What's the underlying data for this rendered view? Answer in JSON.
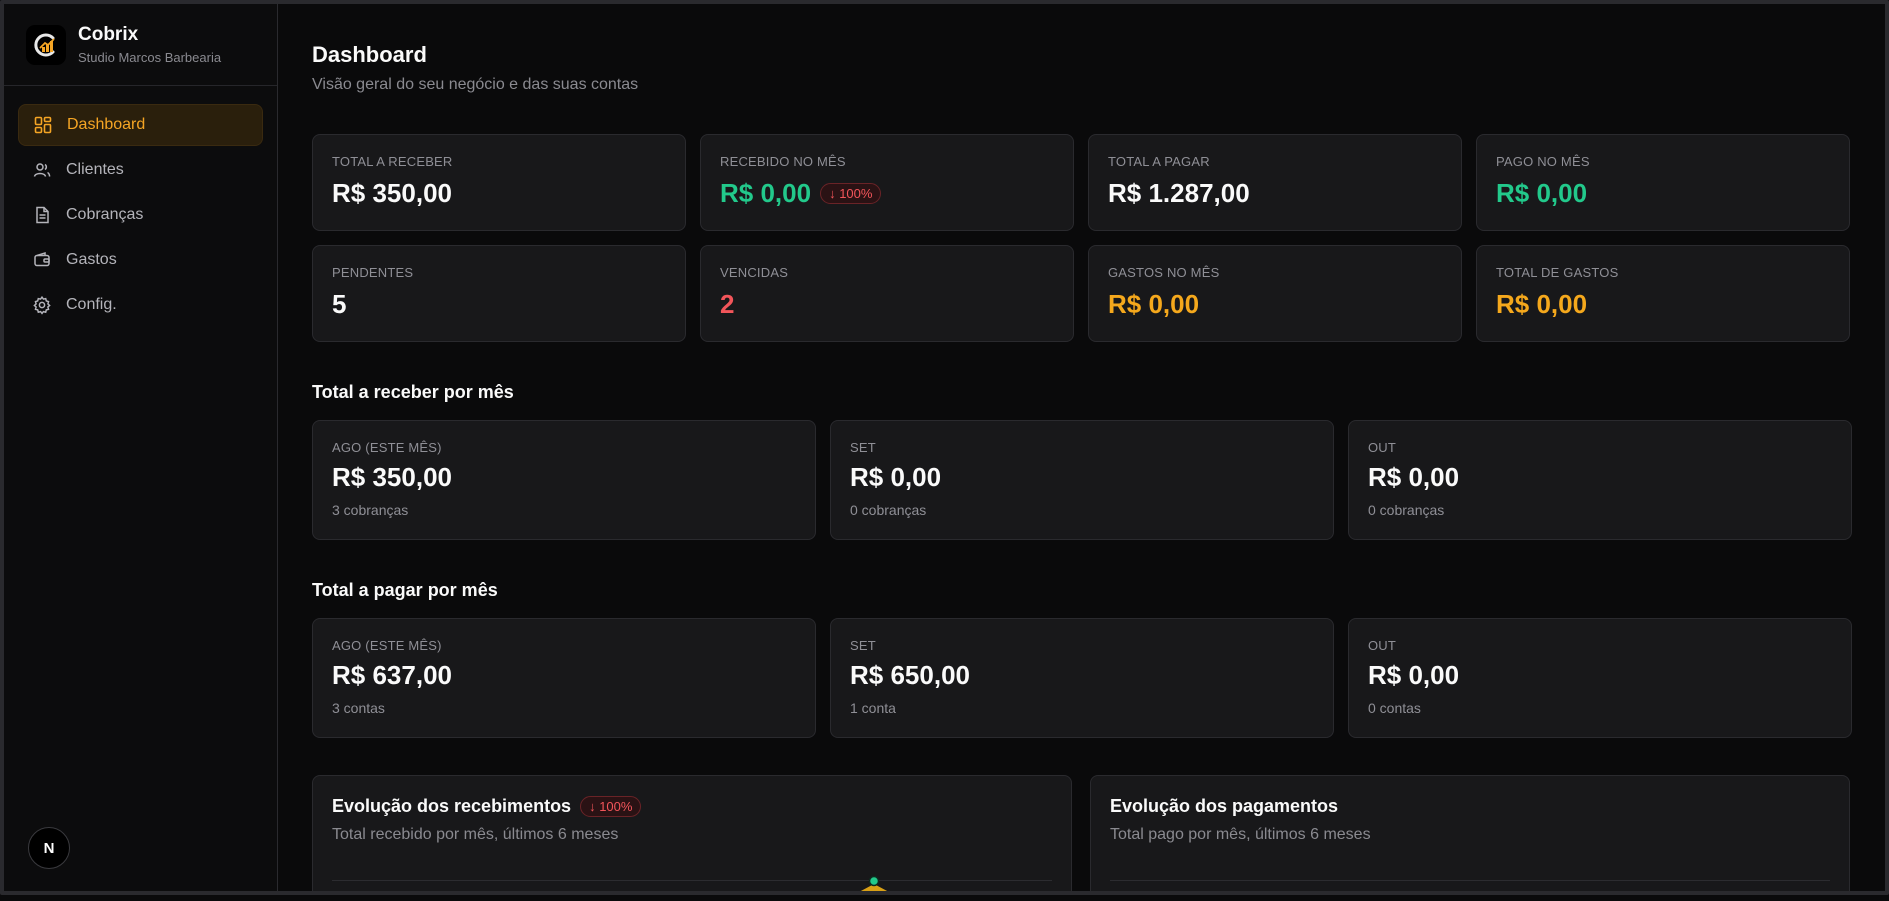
{
  "brand": {
    "name": "Cobrix",
    "subtitle": "Studio Marcos Barbearia"
  },
  "nav": [
    {
      "label": "Dashboard",
      "icon": "dashboard-icon",
      "active": true
    },
    {
      "label": "Clientes",
      "icon": "users-icon"
    },
    {
      "label": "Cobranças",
      "icon": "document-icon"
    },
    {
      "label": "Gastos",
      "icon": "wallet-icon"
    },
    {
      "label": "Config.",
      "icon": "gear-icon"
    }
  ],
  "footer_badge": "N",
  "header": {
    "title": "Dashboard",
    "subtitle": "Visão geral do seu negócio e das suas contas"
  },
  "stats": [
    {
      "label": "TOTAL A RECEBER",
      "value": "R$ 350,00",
      "color": "#fafafa"
    },
    {
      "label": "RECEBIDO NO MÊS",
      "value": "R$ 0,00",
      "color": "#22c98b",
      "badge": "↓ 100%"
    },
    {
      "label": "TOTAL A PAGAR",
      "value": "R$ 1.287,00",
      "color": "#fafafa"
    },
    {
      "label": "PAGO NO MÊS",
      "value": "R$ 0,00",
      "color": "#22c98b"
    },
    {
      "label": "PENDENTES",
      "value": "5",
      "color": "#fafafa"
    },
    {
      "label": "VENCIDAS",
      "value": "2",
      "color": "#f2555a"
    },
    {
      "label": "GASTOS NO MÊS",
      "value": "R$ 0,00",
      "color": "#f5a81c"
    },
    {
      "label": "TOTAL DE GASTOS",
      "value": "R$ 0,00",
      "color": "#f5a81c"
    }
  ],
  "receivable": {
    "title": "Total a receber por mês",
    "months": [
      {
        "label": "AGO (ESTE MÊS)",
        "value": "R$ 350,00",
        "note": "3 cobranças"
      },
      {
        "label": "SET",
        "value": "R$ 0,00",
        "note": "0 cobranças"
      },
      {
        "label": "OUT",
        "value": "R$ 0,00",
        "note": "0 cobranças"
      }
    ]
  },
  "payable": {
    "title": "Total a pagar por mês",
    "months": [
      {
        "label": "AGO (ESTE MÊS)",
        "value": "R$ 637,00",
        "note": "3 contas"
      },
      {
        "label": "SET",
        "value": "R$ 650,00",
        "note": "1 conta"
      },
      {
        "label": "OUT",
        "value": "R$ 0,00",
        "note": "0 contas"
      }
    ]
  },
  "charts": [
    {
      "title": "Evolução dos recebimentos",
      "badge": "↓ 100%",
      "subtitle": "Total recebido por mês, últimos 6 meses"
    },
    {
      "title": "Evolução dos pagamentos",
      "subtitle": "Total pago por mês, últimos 6 meses"
    }
  ],
  "colors": {
    "accent": "#f5a524",
    "positive": "#22c98b",
    "negative": "#f2555a",
    "warning": "#f5a81c"
  }
}
